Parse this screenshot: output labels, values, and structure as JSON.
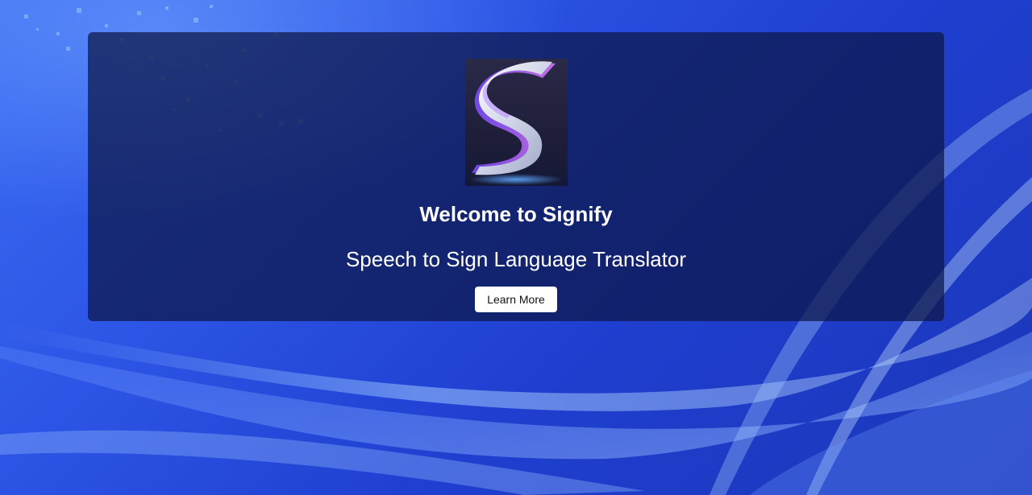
{
  "hero": {
    "title": "Welcome to Signify",
    "subtitle": "Speech to Sign Language Translator",
    "learn_more_label": "Learn More"
  },
  "colors": {
    "background_primary": "#2d55e6",
    "card_overlay": "#0c1646",
    "button_background": "#ffffff",
    "text_light": "#ffffff"
  },
  "icons": {
    "logo": "signify-s-logo"
  }
}
